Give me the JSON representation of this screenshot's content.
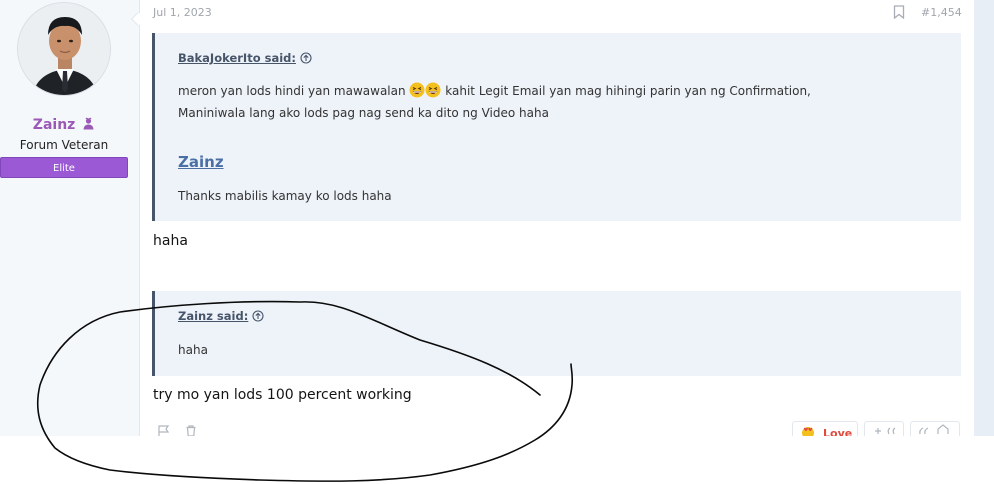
{
  "user": {
    "name": "Zainz",
    "title": "Forum Veteran",
    "banner": "Elite"
  },
  "post": {
    "date": "Jul 1, 2023",
    "number": "#1,454",
    "quote1": {
      "author": "BakaJokerIto said:",
      "line1_part1": "meron yan lods hindi yan mawawalan",
      "line1_part2": "kahit Legit Email yan mag hihingi parin yan ng Confirmation,",
      "line2": "Maniniwala lang ako lods pag nag send ka dito ng Video haha",
      "nested_author": "Zainz",
      "nested_text": "Thanks mabilis kamay ko lods haha"
    },
    "reply1": "haha",
    "quote2": {
      "author": "Zainz said:",
      "text": "haha"
    },
    "reply2": "try mo yan lods 100 percent working",
    "reaction_label": "Love"
  },
  "icons": {
    "bookmark": "bookmark-icon",
    "quote_up": "arrow-up-circle-icon",
    "emoji": "grinning-squinting-face-emoji",
    "report": "flag-icon",
    "delete": "trash-icon",
    "heart": "heart-eyes-icon",
    "crown": "crown-user-icon"
  },
  "colors": {
    "username": "#9b59b6",
    "banner": "#9b59d6",
    "quote_bg": "#eef3f9",
    "quote_border": "#47556a",
    "nested_author": "#4a6fa5"
  }
}
